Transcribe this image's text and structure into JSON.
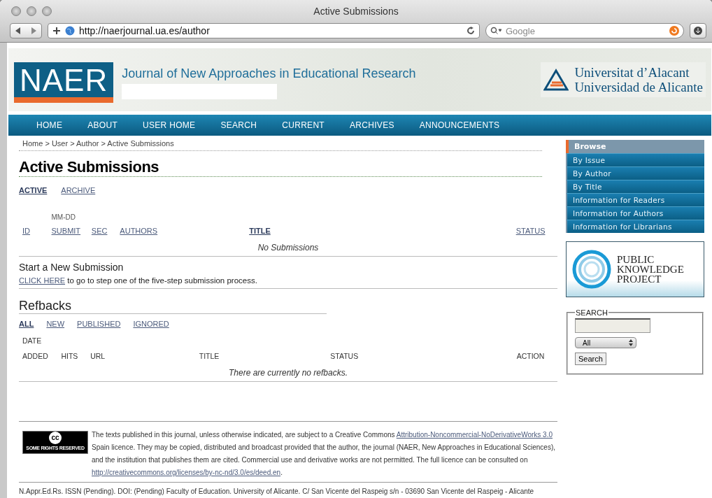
{
  "window": {
    "title": "Active Submissions"
  },
  "toolbar": {
    "url": "http://naerjournal.ua.es/author",
    "search_placeholder": "Google"
  },
  "header": {
    "logo": "NAER",
    "journal_title": "Journal of New Approaches in Educational Research",
    "university": [
      "Universitat d’Alacant",
      "Universidad de Alicante"
    ]
  },
  "nav": {
    "items": [
      "HOME",
      "ABOUT",
      "USER HOME",
      "SEARCH",
      "CURRENT",
      "ARCHIVES",
      "ANNOUNCEMENTS"
    ]
  },
  "breadcrumb": "Home > User > Author > Active Submissions",
  "page_title": "Active Submissions",
  "tabs": [
    {
      "label": "ACTIVE",
      "selected": true
    },
    {
      "label": "ARCHIVE",
      "selected": false
    }
  ],
  "submissions": {
    "columns": [
      {
        "label": "ID",
        "sorted": false
      },
      {
        "top": "MM-DD",
        "label": "SUBMIT",
        "sorted": false
      },
      {
        "label": "SEC",
        "sorted": false
      },
      {
        "label": "AUTHORS",
        "sorted": false
      },
      {
        "label": "TITLE",
        "sorted": true
      },
      {
        "label": "STATUS",
        "sorted": false
      }
    ],
    "empty": "No Submissions"
  },
  "new_submission": {
    "heading": "Start a New Submission",
    "link": "CLICK HERE",
    "text": "to go to step one of the five-step submission process."
  },
  "refbacks": {
    "heading": "Refbacks",
    "filters": [
      {
        "label": "ALL",
        "selected": true
      },
      {
        "label": "NEW",
        "selected": false
      },
      {
        "label": "PUBLISHED",
        "selected": false
      },
      {
        "label": "IGNORED",
        "selected": false
      }
    ],
    "columns": [
      {
        "top": "DATE",
        "label": "ADDED"
      },
      {
        "label": "HITS"
      },
      {
        "label": "URL"
      },
      {
        "label": "TITLE"
      },
      {
        "label": "STATUS"
      },
      {
        "label": "ACTION"
      }
    ],
    "empty": "There are currently no refbacks."
  },
  "footer": {
    "badge_symbol": "cc",
    "badge_text": "SOME RIGHTS RESERVED",
    "licence": [
      {
        "kind": "text",
        "text": "The texts published in this journal, unless otherwise indicated, are subject to a Creative Commons "
      },
      {
        "kind": "link",
        "text": "Attribution-Noncommercial-NoDerivativeWorks 3.0"
      },
      {
        "kind": "text",
        "text": " Spain licence. They may be copied, distributed and broadcast provided that the author, the journal (NAER, New Approaches in Educational Sciences), and the institution that publishes them are cited. Commercial use and derivative works are not permitted. The full licence can be consulted on "
      },
      {
        "kind": "link",
        "text": "http://creativecommons.org/licenses/by-nc-nd/3.0/es/deed.en"
      },
      {
        "kind": "text",
        "text": "."
      }
    ],
    "address": "N.Appr.Ed.Rs. ISSN (Pending). DOI: (Pending) Faculty of Education. University of Alicante. C/ San Vicente del Raspeig s/n - 03690 San Vicente del Raspeig - Alicante"
  },
  "sidebar": {
    "browse_title": "Browse",
    "items": [
      "By Issue",
      "By Author",
      "By Title",
      "Information for Readers",
      "Information for Authors",
      "Information for Librarians"
    ],
    "pkp_logo": [
      "PUBLIC",
      "KNOWLEDGE",
      "PROJECT"
    ],
    "search": {
      "legend": "SEARCH",
      "scope": "All",
      "button": "Search"
    }
  }
}
